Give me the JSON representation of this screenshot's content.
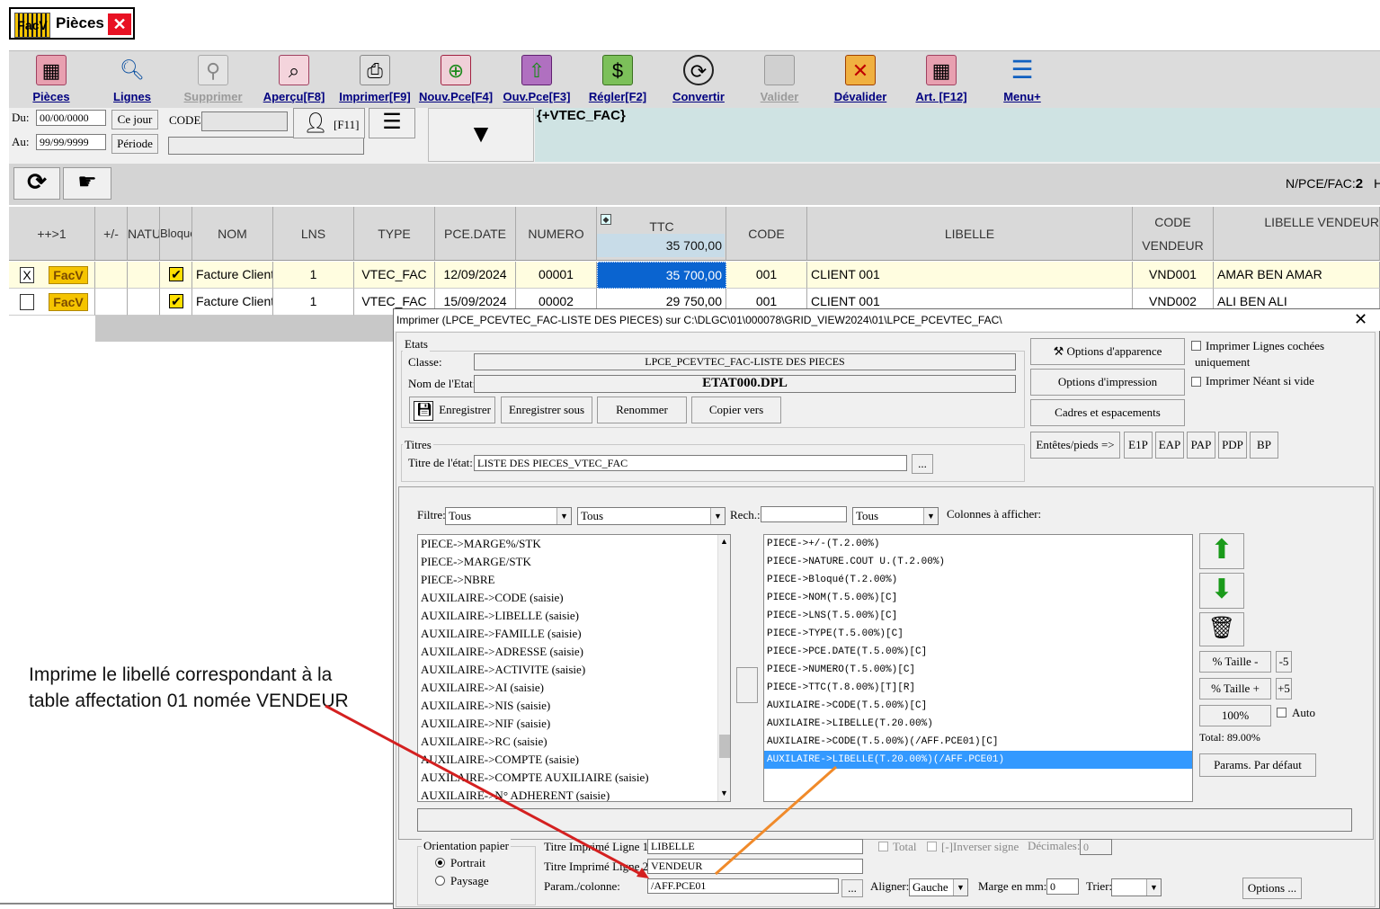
{
  "window": {
    "logo": "FacV",
    "title": "Pièces",
    "close": "✕"
  },
  "toolbar": [
    {
      "label": "Pièces",
      "icon": "grid-icon",
      "disabled": false
    },
    {
      "label": "Lignes",
      "icon": "magnifier-icon",
      "disabled": false
    },
    {
      "label": "Supprimer",
      "icon": "trash-person-icon",
      "disabled": true
    },
    {
      "label": "Aperçu[F8]",
      "icon": "preview-icon",
      "disabled": false
    },
    {
      "label": "Imprimer[F9]",
      "icon": "printer-icon",
      "disabled": false
    },
    {
      "label": "Nouv.Pce[F4]",
      "icon": "new-piece-icon",
      "disabled": false
    },
    {
      "label": "Ouv.Pce[F3]",
      "icon": "open-piece-icon",
      "disabled": false
    },
    {
      "label": "Régler[F2]",
      "icon": "money-icon",
      "disabled": false
    },
    {
      "label": "Convertir",
      "icon": "convert-icon",
      "disabled": false
    },
    {
      "label": "Valider",
      "icon": "validate-icon",
      "disabled": true
    },
    {
      "label": "Dévalider",
      "icon": "unvalidate-icon",
      "disabled": false
    },
    {
      "label": "Art. [F12]",
      "icon": "articles-icon",
      "disabled": false
    },
    {
      "label": "Menu+",
      "icon": "menu-icon",
      "disabled": false
    }
  ],
  "filters": {
    "du_label": "Du:",
    "du_value": "00/00/0000",
    "au_label": "Au:",
    "au_value": "99/99/9999",
    "ce_jour": "Ce jour",
    "periode": "Période",
    "code_label": "CODE:",
    "f11": "[F11]",
    "vtec": "{+VTEC_FAC}",
    "count_label": "N/PCE/FAC:",
    "count_value": "2",
    "ht_label": "HT"
  },
  "grid": {
    "headers": [
      "++>1",
      "+/-",
      "NATU",
      "Bloqué",
      "NOM",
      "LNS",
      "TYPE",
      "PCE.DATE",
      "NUMERO",
      "TTC",
      "CODE",
      "LIBELLE",
      "CODE VENDEUR",
      "LIBELLE VENDEUR"
    ],
    "ttc_total": "35 700,00",
    "rows": [
      {
        "check": "X",
        "badge": "FacV",
        "nom": "Facture Client",
        "lns": "1",
        "type": "VTEC_FAC",
        "date": "12/09/2024",
        "numero": "00001",
        "ttc": "35 700,00",
        "code": "001",
        "libelle": "CLIENT 001",
        "code_vendeur": "VND001",
        "libelle_vendeur": "AMAR BEN AMAR"
      },
      {
        "check": "",
        "badge": "FacV",
        "nom": "Facture Client",
        "lns": "1",
        "type": "VTEC_FAC",
        "date": "15/09/2024",
        "numero": "00002",
        "ttc": "29 750,00",
        "code": "001",
        "libelle": "CLIENT 001",
        "code_vendeur": "VND002",
        "libelle_vendeur": "ALI BEN ALI"
      }
    ]
  },
  "dialog": {
    "title": "Imprimer (LPCE_PCEVTEC_FAC-LISTE DES PIECES)  sur C:\\DLGC\\01\\000078\\GRID_VIEW2024\\01\\LPCE_PCEVTEC_FAC\\",
    "etats_group": "Etats",
    "classe_label": "Classe:",
    "classe_value": "LPCE_PCEVTEC_FAC-LISTE DES PIECES",
    "nom_label": "Nom de l'Etat:",
    "nom_value": "ETAT000.DPL",
    "btn_enregistrer": "Enregistrer",
    "btn_enregistrer_sous": "Enregistrer sous",
    "btn_renommer": "Renommer",
    "btn_copier": "Copier vers",
    "btn_apparence": "Options d'apparence",
    "btn_impression": "Options d'impression",
    "btn_cadres": "Cadres et espacements",
    "entetes": "Entêtes/pieds =>",
    "e1p": "E1P",
    "eap": "EAP",
    "pap": "PAP",
    "pdp": "PDP",
    "bp": "BP",
    "chk_cochees": "Imprimer Lignes cochées uniquement",
    "chk_neant": "Imprimer Néant si vide",
    "titres_group": "Titres",
    "titre_label": "Titre de l'état:",
    "titre_value": "LISTE DES PIECES_VTEC_FAC",
    "dots": "...",
    "filtre_label": "Filtre:",
    "combo_tous": "Tous",
    "rech_label": "Rech.:",
    "colonnes_label": "Colonnes à afficher:",
    "available": [
      "PIECE->MARGE%/STK",
      "PIECE->MARGE/STK",
      "PIECE->NBRE",
      "AUXILAIRE->CODE (saisie)",
      "AUXILAIRE->LIBELLE (saisie)",
      "AUXILAIRE->FAMILLE (saisie)",
      "AUXILAIRE->ADRESSE (saisie)",
      "AUXILAIRE->ACTIVITE (saisie)",
      "AUXILAIRE->AI (saisie)",
      "AUXILAIRE->NIS (saisie)",
      "AUXILAIRE->NIF (saisie)",
      "AUXILAIRE->RC (saisie)",
      "AUXILAIRE->COMPTE (saisie)",
      "AUXILAIRE->COMPTE AUXILIAIRE (saisie)",
      "AUXILAIRE->N° ADHERENT (saisie)"
    ],
    "selected": [
      "PIECE->+/-(T.2.00%)",
      "PIECE->NATURE.COUT U.(T.2.00%)",
      "PIECE->Bloqué(T.2.00%)",
      "PIECE->NOM(T.5.00%)[C]",
      "PIECE->LNS(T.5.00%)[C]",
      "PIECE->TYPE(T.5.00%)[C]",
      "PIECE->PCE.DATE(T.5.00%)[C]",
      "PIECE->NUMERO(T.5.00%)[C]",
      "PIECE->TTC(T.8.00%)[T][R]",
      "AUXILAIRE->CODE(T.5.00%)[C]",
      "AUXILAIRE->LIBELLE(T.20.00%)",
      "AUXILAIRE->CODE(T.5.00%)(/AFF.PCE01)[C]",
      "AUXILAIRE->LIBELLE(T.20.00%)(/AFF.PCE01)"
    ],
    "taille_minus": "% Taille -",
    "taille_plus": "% Taille +",
    "m5": "-5",
    "p5": "+5",
    "cent": "100%",
    "auto": "Auto",
    "total": "Total:  89.00%",
    "params_defaut": "Params. Par défaut",
    "orientation_group": "Orientation papier",
    "portrait": "Portrait",
    "paysage": "Paysage",
    "titre1_label": "Titre Imprimé Ligne 1:",
    "titre1_value": "LIBELLE",
    "titre2_label": "Titre Imprimé Ligne 2:",
    "titre2_value": "VENDEUR",
    "param_label": "Param./colonne:",
    "param_value": "/AFF.PCE01",
    "chk_total": "Total",
    "chk_inverser": "[-]Inverser signe",
    "decimales_label": "Décimales:",
    "decimales_value": "0",
    "aligner_label": "Aligner:",
    "aligner_value": "Gauche",
    "marge_label": "Marge en mm:",
    "marge_value": "0",
    "trier_label": "Trier:",
    "options": "Options ..."
  },
  "annotation": "Imprime le libellé correspondant à la table affectation 01 nomée VENDEUR",
  "colors": {
    "selection": "#3399ff",
    "ttc_selected": "#0a64d0",
    "arrow_red": "#d42020",
    "arrow_orange": "#f08a2a",
    "badge": "#f5c400"
  }
}
